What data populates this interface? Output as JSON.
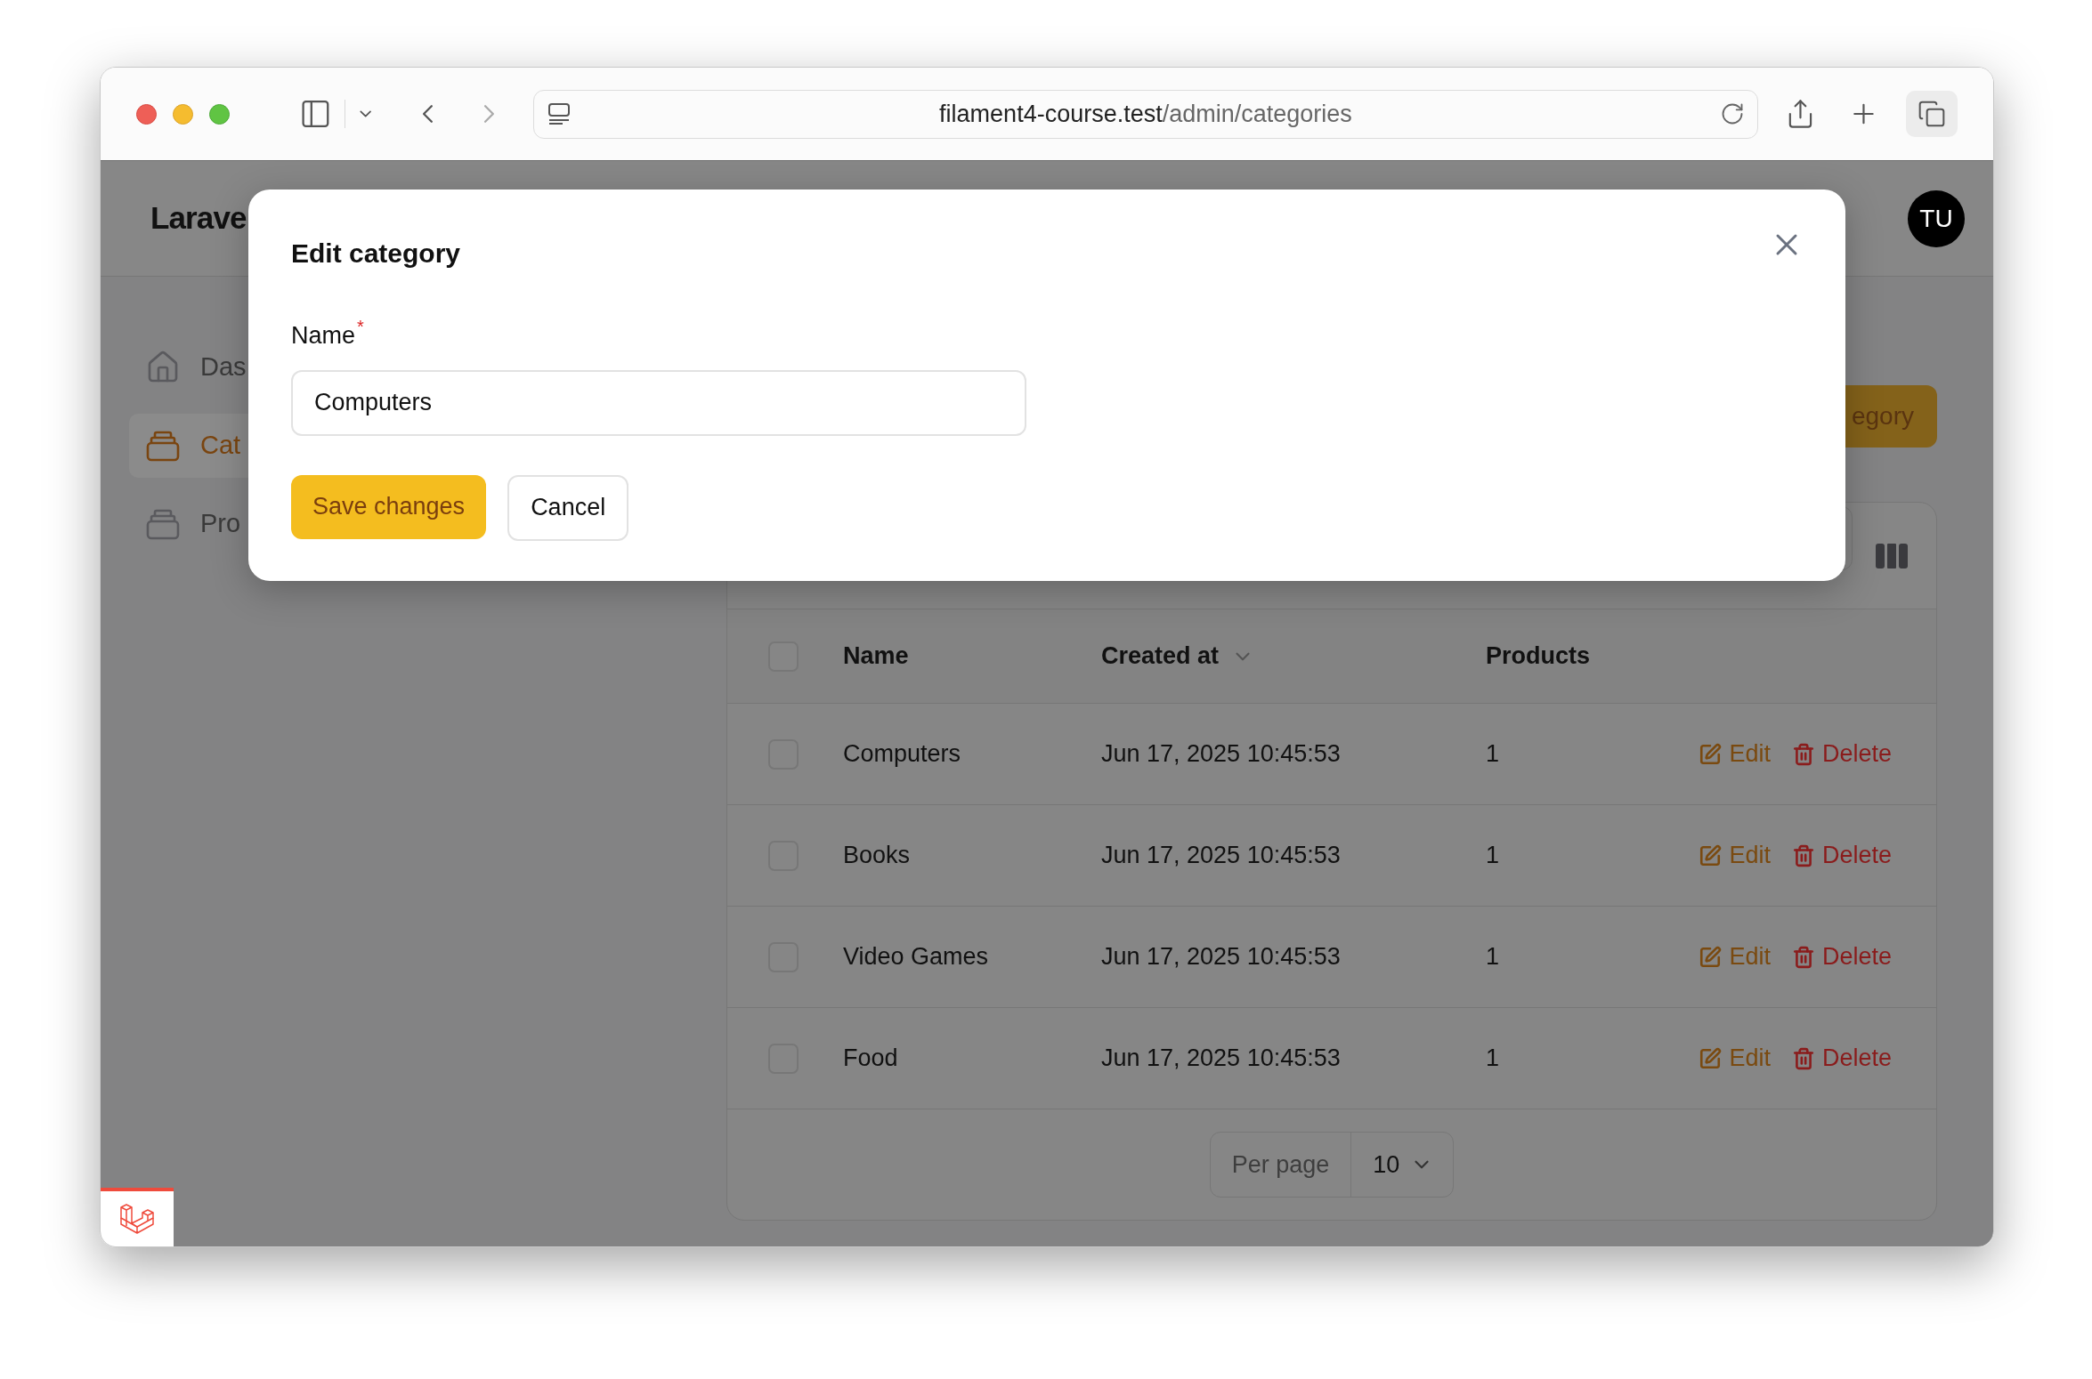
{
  "browser": {
    "url_host": "filament4-course.test",
    "url_path": "/admin/categories"
  },
  "app": {
    "brand": "Larave",
    "avatar": "TU"
  },
  "sidebar": {
    "items": [
      {
        "label": "Das",
        "kind": "home",
        "selected": false
      },
      {
        "label": "Cat",
        "kind": "stack",
        "selected": true
      },
      {
        "label": "Pro",
        "kind": "stack",
        "selected": false
      }
    ]
  },
  "header_action": {
    "label": "egory"
  },
  "table": {
    "select_all_checked": false,
    "columns": [
      {
        "label": "Name",
        "sorted": false
      },
      {
        "label": "Created at",
        "sorted": true
      },
      {
        "label": "Products",
        "sorted": false
      }
    ],
    "rows": [
      {
        "checked": false,
        "cells": [
          "Computers",
          "Jun 17, 2025 10:45:53",
          "1"
        ],
        "actions": [
          {
            "label": "Edit",
            "kind": "edit"
          },
          {
            "label": "Delete",
            "kind": "delete"
          }
        ]
      },
      {
        "checked": false,
        "cells": [
          "Books",
          "Jun 17, 2025 10:45:53",
          "1"
        ],
        "actions": [
          {
            "label": "Edit",
            "kind": "edit"
          },
          {
            "label": "Delete",
            "kind": "delete"
          }
        ]
      },
      {
        "checked": false,
        "cells": [
          "Video Games",
          "Jun 17, 2025 10:45:53",
          "1"
        ],
        "actions": [
          {
            "label": "Edit",
            "kind": "edit"
          },
          {
            "label": "Delete",
            "kind": "delete"
          }
        ]
      },
      {
        "checked": false,
        "cells": [
          "Food",
          "Jun 17, 2025 10:45:53",
          "1"
        ],
        "actions": [
          {
            "label": "Edit",
            "kind": "edit"
          },
          {
            "label": "Delete",
            "kind": "delete"
          }
        ]
      }
    ]
  },
  "pagination": {
    "label": "Per page",
    "value": "10"
  },
  "modal": {
    "title": "Edit category",
    "field": {
      "label": "Name",
      "required_mark": "*",
      "value": "Computers"
    },
    "buttons": [
      {
        "label": "Save changes",
        "kind": "primary"
      },
      {
        "label": "Cancel",
        "kind": "secondary"
      }
    ]
  }
}
